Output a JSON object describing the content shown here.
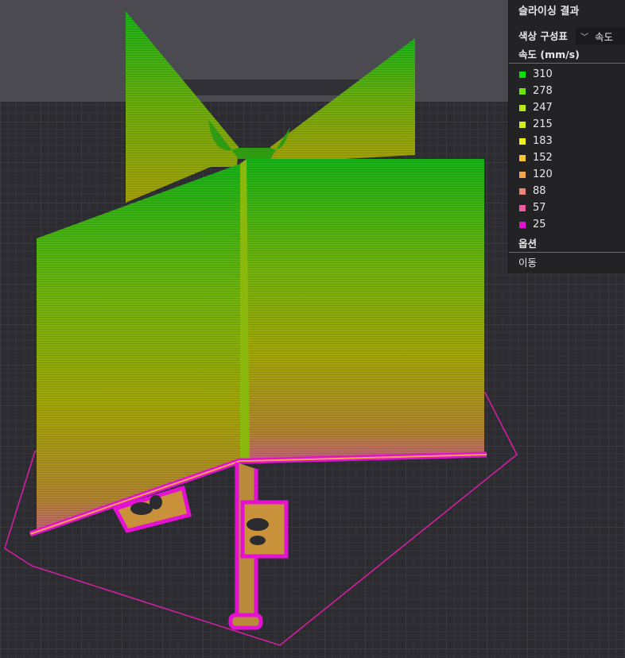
{
  "panel": {
    "title": "슬라이싱 결과",
    "color_scheme_label": "색상 구성표",
    "color_scheme_value": "속도",
    "legend_header": "속도 (mm/s)",
    "legend": [
      {
        "label": "310",
        "color": "#0be00b"
      },
      {
        "label": "278",
        "color": "#6fe40c"
      },
      {
        "label": "247",
        "color": "#b7ea14"
      },
      {
        "label": "215",
        "color": "#d6ee17"
      },
      {
        "label": "183",
        "color": "#f6f018"
      },
      {
        "label": "152",
        "color": "#f5c531"
      },
      {
        "label": "120",
        "color": "#f4a64a"
      },
      {
        "label": "88",
        "color": "#ed8472"
      },
      {
        "label": "57",
        "color": "#ec5aa0"
      },
      {
        "label": "25",
        "color": "#e411d3"
      }
    ],
    "options_header": "옵션",
    "options": [
      {
        "label": "이동"
      }
    ]
  },
  "viewport": {
    "background_color": "#2e2e33",
    "grid_color": "#3c3c42",
    "skirt_color": "#d21fa0"
  }
}
